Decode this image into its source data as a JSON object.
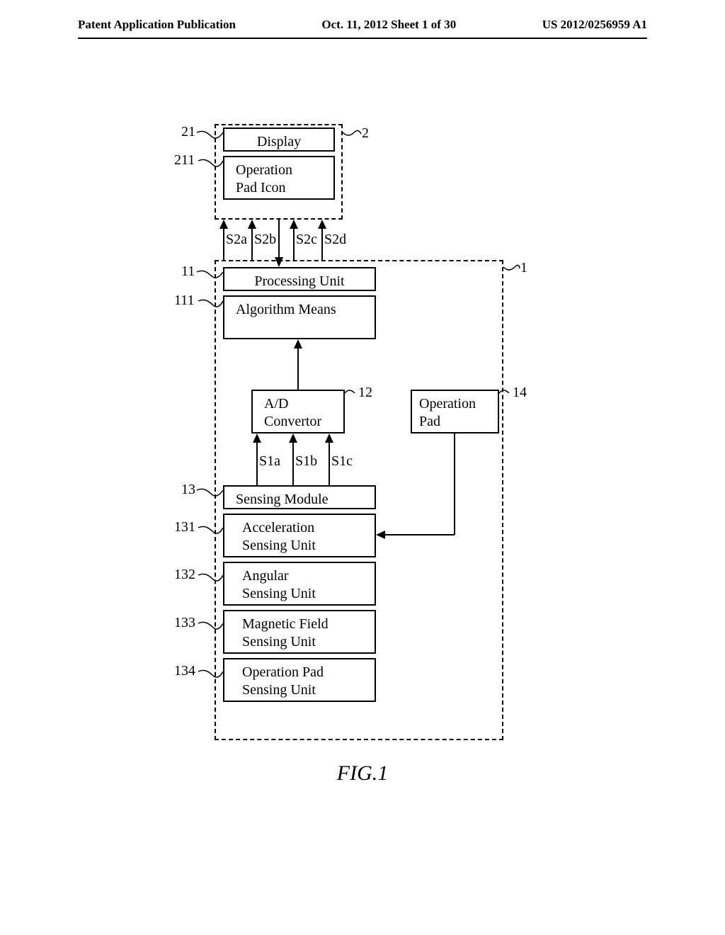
{
  "header": {
    "left": "Patent Application Publication",
    "center": "Oct. 11, 2012  Sheet 1 of 30",
    "right": "US 2012/0256959 A1"
  },
  "blocks": {
    "display": "Display",
    "op_pad_icon": "Operation\nPad Icon",
    "proc_unit": "Processing Unit",
    "algo": "Algorithm Means",
    "adc": "A/D\nConvertor",
    "op_pad": "Operation\nPad",
    "sensing_module": "Sensing Module",
    "accel": "Acceleration\nSensing Unit",
    "angular": "Angular\nSensing Unit",
    "mag": "Magnetic Field\nSensing Unit",
    "op_pad_su": "Operation Pad\nSensing Unit"
  },
  "refs": {
    "r21": "21",
    "r211": "211",
    "r2": "2",
    "r11": "11",
    "r111": "111",
    "r1": "1",
    "r12": "12",
    "r14": "14",
    "r13": "13",
    "r131": "131",
    "r132": "132",
    "r133": "133",
    "r134": "134"
  },
  "signals": {
    "s2a": "S2a",
    "s2b": "S2b",
    "s2c": "S2c",
    "s2d": "S2d",
    "s1a": "S1a",
    "s1b": "S1b",
    "s1c": "S1c"
  },
  "caption": "FIG.1"
}
